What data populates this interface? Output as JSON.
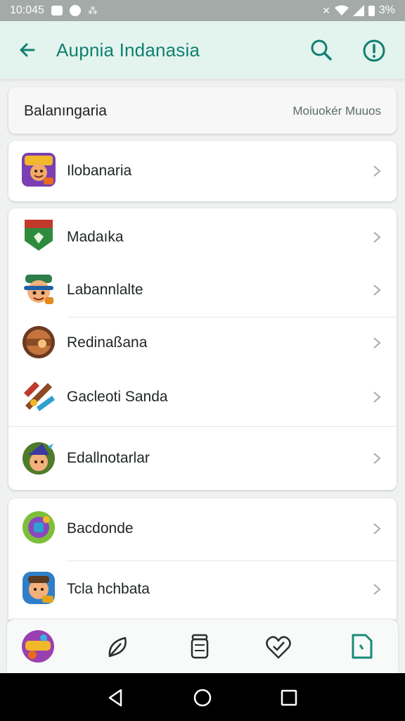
{
  "status_bar": {
    "time": "10:045",
    "battery": "3%",
    "icons": [
      "image-icon",
      "circle-icon",
      "signal-dots-icon",
      "mute-icon",
      "wifi-icon",
      "signal-icon",
      "battery-icon"
    ]
  },
  "app_bar": {
    "title": "Aupnia Indanasia",
    "icons": [
      "back-arrow-icon",
      "search-icon",
      "info-icon"
    ],
    "accent_color": "#10806f"
  },
  "summary": {
    "label": "Balanıngaria",
    "value": "Moiuokér Muuos"
  },
  "groups": [
    {
      "items": [
        {
          "label": "Ilobanaria",
          "icon": "game-character-icon"
        }
      ]
    },
    {
      "items": [
        {
          "label": "Madaıka",
          "icon": "shield-badge-icon"
        },
        {
          "label": "Labannlalte",
          "icon": "pirate-character-icon"
        },
        {
          "label": "Redinaßana",
          "icon": "barrel-icon"
        },
        {
          "label": "Gacleoti Sanda",
          "icon": "tools-icon"
        },
        {
          "label": "Edallnotarlar",
          "icon": "wizard-character-icon"
        }
      ]
    },
    {
      "items": [
        {
          "label": "Bacdonde",
          "icon": "potion-icon"
        },
        {
          "label": "Tcla hchbata",
          "icon": "adventurer-character-icon"
        }
      ]
    }
  ],
  "bottom_nav": {
    "items": [
      "game-logo-icon",
      "leaf-icon",
      "jar-icon",
      "heart-check-icon",
      "document-icon"
    ],
    "active_color": "#1a8a76"
  },
  "system_nav": {
    "items": [
      "back-triangle-icon",
      "home-circle-icon",
      "recents-square-icon"
    ]
  }
}
